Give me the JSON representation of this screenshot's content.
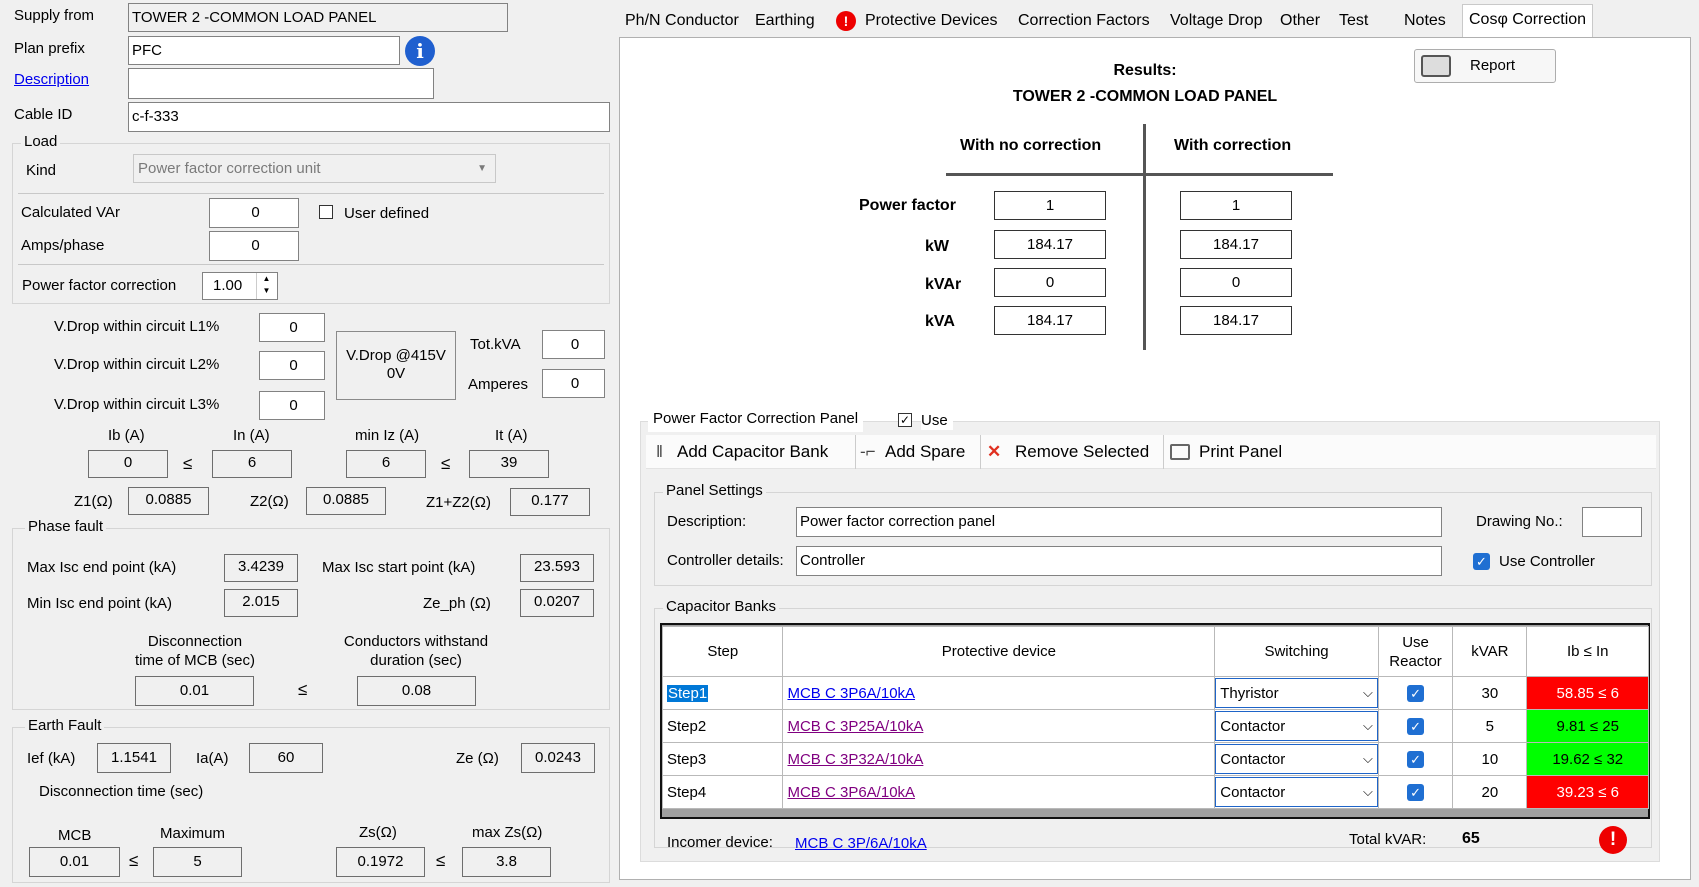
{
  "left": {
    "supply_from_label": "Supply from",
    "supply_from": "TOWER 2 -COMMON LOAD PANEL",
    "plan_prefix_label": "Plan prefix",
    "plan_prefix": "PFC",
    "description_label": "Description",
    "description": "",
    "cable_id_label": "Cable ID",
    "cable_id": "c-f-333",
    "load_title": "Load",
    "kind_label": "Kind",
    "kind": "Power factor correction unit",
    "calc_var_label": "Calculated VAr",
    "calc_var": "0",
    "user_defined": "User defined",
    "amps_label": "Amps/phase",
    "amps": "0",
    "pfc_label": "Power factor correction",
    "pfc": "1.00",
    "vd1_label": "V.Drop within circuit L1%",
    "vd1": "0",
    "vd2_label": "V.Drop within circuit L2%",
    "vd2": "0",
    "vd3_label": "V.Drop within circuit L3%",
    "vd3": "0",
    "vdrop_box_line1": "V.Drop @415V",
    "vdrop_box_line2": "0V",
    "totkva_label": "Tot.kVA",
    "totkva": "0",
    "amperes_label": "Amperes",
    "amperes": "0",
    "ib_label": "Ib (A)",
    "ib": "0",
    "in_label": "In (A)",
    "in": "6",
    "miniz_label": "min Iz (A)",
    "miniz": "6",
    "it_label": "It (A)",
    "it": "39",
    "le": "≤",
    "z1_label": "Z1(Ω)",
    "z1": "0.0885",
    "z2_label": "Z2(Ω)",
    "z2": "0.0885",
    "z12_label": "Z1+Z2(Ω)",
    "z12": "0.177",
    "phase_fault_title": "Phase fault",
    "max_isc_end_label": "Max Isc end point (kA)",
    "max_isc_end": "3.4239",
    "max_isc_start_label": "Max Isc start point (kA)",
    "max_isc_start": "23.593",
    "min_isc_end_label": "Min Isc end point (kA)",
    "min_isc_end": "2.015",
    "zeph_label": "Ze_ph (Ω)",
    "zeph": "0.0207",
    "disc_label1": "Disconnection",
    "disc_label2": "time of MCB (sec)",
    "disc": "0.01",
    "withstand_label1": "Conductors withstand",
    "withstand_label2": "duration (sec)",
    "withstand": "0.08",
    "earth_fault_title": "Earth Fault",
    "ief_label": "Ief (kA)",
    "ief": "1.1541",
    "ia_label": "Ia(A)",
    "ia": "60",
    "ze_label": "Ze (Ω)",
    "ze": "0.0243",
    "disc_time_label": "Disconnection time (sec)",
    "mcb_label": "MCB",
    "mcb": "0.01",
    "maximum_label": "Maximum",
    "maximum": "5",
    "zs_label": "Zs(Ω)",
    "zs": "0.1972",
    "maxzs_label": "max Zs(Ω)",
    "maxzs": "3.8"
  },
  "tabs": [
    "Ph/N Conductor",
    "Earthing",
    "Protective Devices",
    "Correction Factors",
    "Voltage Drop",
    "Other",
    "Test",
    "Notes",
    "Cosφ Correction"
  ],
  "active_tab": "Cosφ Correction",
  "report_label": "Report",
  "results": {
    "title": "Results:",
    "subtitle": "TOWER 2 -COMMON LOAD PANEL",
    "col_no": "With no correction",
    "col_with": "With correction",
    "rows": [
      {
        "label": "Power factor",
        "no": "1",
        "with": "1"
      },
      {
        "label": "kW",
        "no": "184.17",
        "with": "184.17"
      },
      {
        "label": "kVAr",
        "no": "0",
        "with": "0"
      },
      {
        "label": "kVA",
        "no": "184.17",
        "with": "184.17"
      }
    ]
  },
  "pfc_panel": {
    "title": "Power Factor Correction Panel",
    "use_label": "Use",
    "toolbar": {
      "add_bank": "Add Capacitor Bank",
      "add_spare": "Add Spare",
      "remove": "Remove Selected",
      "print": "Print Panel"
    },
    "settings_title": "Panel Settings",
    "description_label": "Description:",
    "description": "Power factor correction panel",
    "drawing_label": "Drawing No.:",
    "drawing": "",
    "controller_label": "Controller details:",
    "controller": "Controller",
    "use_controller": "Use Controller",
    "banks_title": "Capacitor Banks",
    "headers": {
      "step": "Step",
      "device": "Protective device",
      "switching": "Switching",
      "reactor1": "Use",
      "reactor2": "Reactor",
      "kvar": "kVAR",
      "ib": "Ib ≤ In"
    },
    "rows": [
      {
        "step": "Step1",
        "device": "MCB C 3P6A/10kA",
        "switching": "Thyristor",
        "kvar": "30",
        "ib": "58.85 ≤ 6",
        "status": "fail"
      },
      {
        "step": "Step2",
        "device": "MCB C 3P25A/10kA",
        "switching": "Contactor",
        "kvar": "5",
        "ib": "9.81 ≤ 25",
        "status": "ok"
      },
      {
        "step": "Step3",
        "device": "MCB C 3P32A/10kA",
        "switching": "Contactor",
        "kvar": "10",
        "ib": "19.62 ≤ 32",
        "status": "ok"
      },
      {
        "step": "Step4",
        "device": "MCB C 3P6A/10kA",
        "switching": "Contactor",
        "kvar": "20",
        "ib": "39.23 ≤ 6",
        "status": "fail"
      }
    ],
    "incomer_label": "Incomer device:",
    "incomer": "MCB C 3P/6A/10kA",
    "total_label": "Total kVAR:",
    "total": "65"
  },
  "colors": {
    "fail": "#ff0000",
    "ok": "#00ff00",
    "link": "#0000ee",
    "visited": "#800080",
    "accent": "#1f6fd2"
  }
}
